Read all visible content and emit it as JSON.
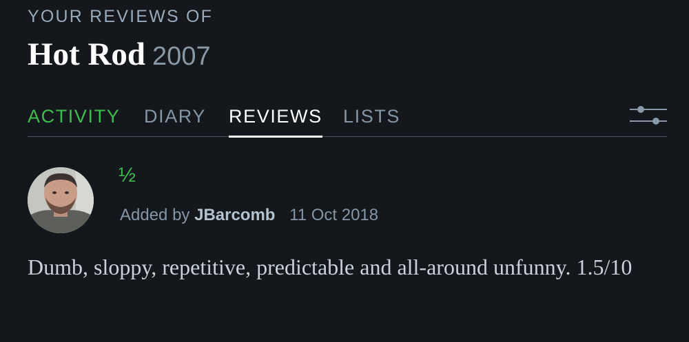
{
  "header": {
    "eyebrow": "YOUR REVIEWS OF",
    "film_title": "Hot Rod",
    "film_year": "2007"
  },
  "tabs": [
    {
      "label": "ACTIVITY",
      "state": "highlighted",
      "color": "#40bc4f"
    },
    {
      "label": "DIARY",
      "state": "default"
    },
    {
      "label": "REVIEWS",
      "state": "selected"
    },
    {
      "label": "LISTS",
      "state": "default"
    }
  ],
  "toolbar": {
    "filter_icon": "sliders-icon"
  },
  "review": {
    "rating": "½",
    "added_by_label": "Added by",
    "author": "JBarcomb",
    "date": "11 Oct 2018",
    "text": "Dumb, sloppy, repetitive, predictable and all-around unfunny. 1.5/10"
  },
  "colors": {
    "background": "#14181c",
    "accent_green": "#40bc4f",
    "muted_text": "#8595a6",
    "primary_text": "#ffffff"
  }
}
